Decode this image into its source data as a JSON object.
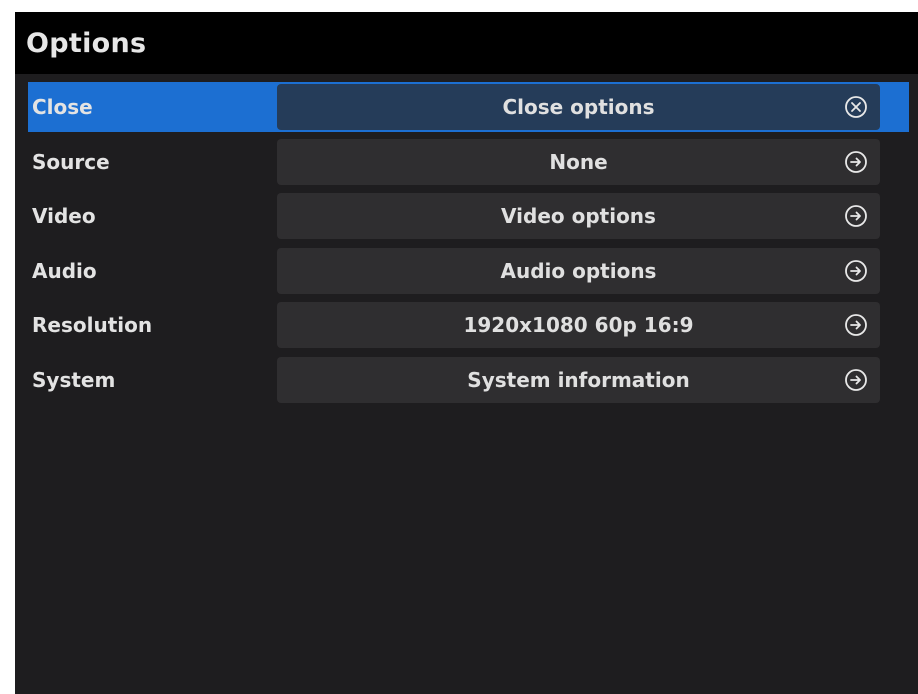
{
  "window": {
    "title": "Options"
  },
  "menu": {
    "items": [
      {
        "label": "Close",
        "value": "Close options",
        "icon": "close-circle-icon",
        "selected": true
      },
      {
        "label": "Source",
        "value": "None",
        "icon": "arrow-right-circle-icon",
        "selected": false
      },
      {
        "label": "Video",
        "value": "Video options",
        "icon": "arrow-right-circle-icon",
        "selected": false
      },
      {
        "label": "Audio",
        "value": "Audio options",
        "icon": "arrow-right-circle-icon",
        "selected": false
      },
      {
        "label": "Resolution",
        "value": "1920x1080 60p 16:9",
        "icon": "arrow-right-circle-icon",
        "selected": false
      },
      {
        "label": "System",
        "value": "System information",
        "icon": "arrow-right-circle-icon",
        "selected": false
      }
    ]
  },
  "colors": {
    "background": "#1e1d1f",
    "title_bar": "#000000",
    "selected_row": "#1c6fd2",
    "selected_value": "#253c59",
    "value_box": "#2f2e30",
    "text": "#e3e3e3"
  }
}
